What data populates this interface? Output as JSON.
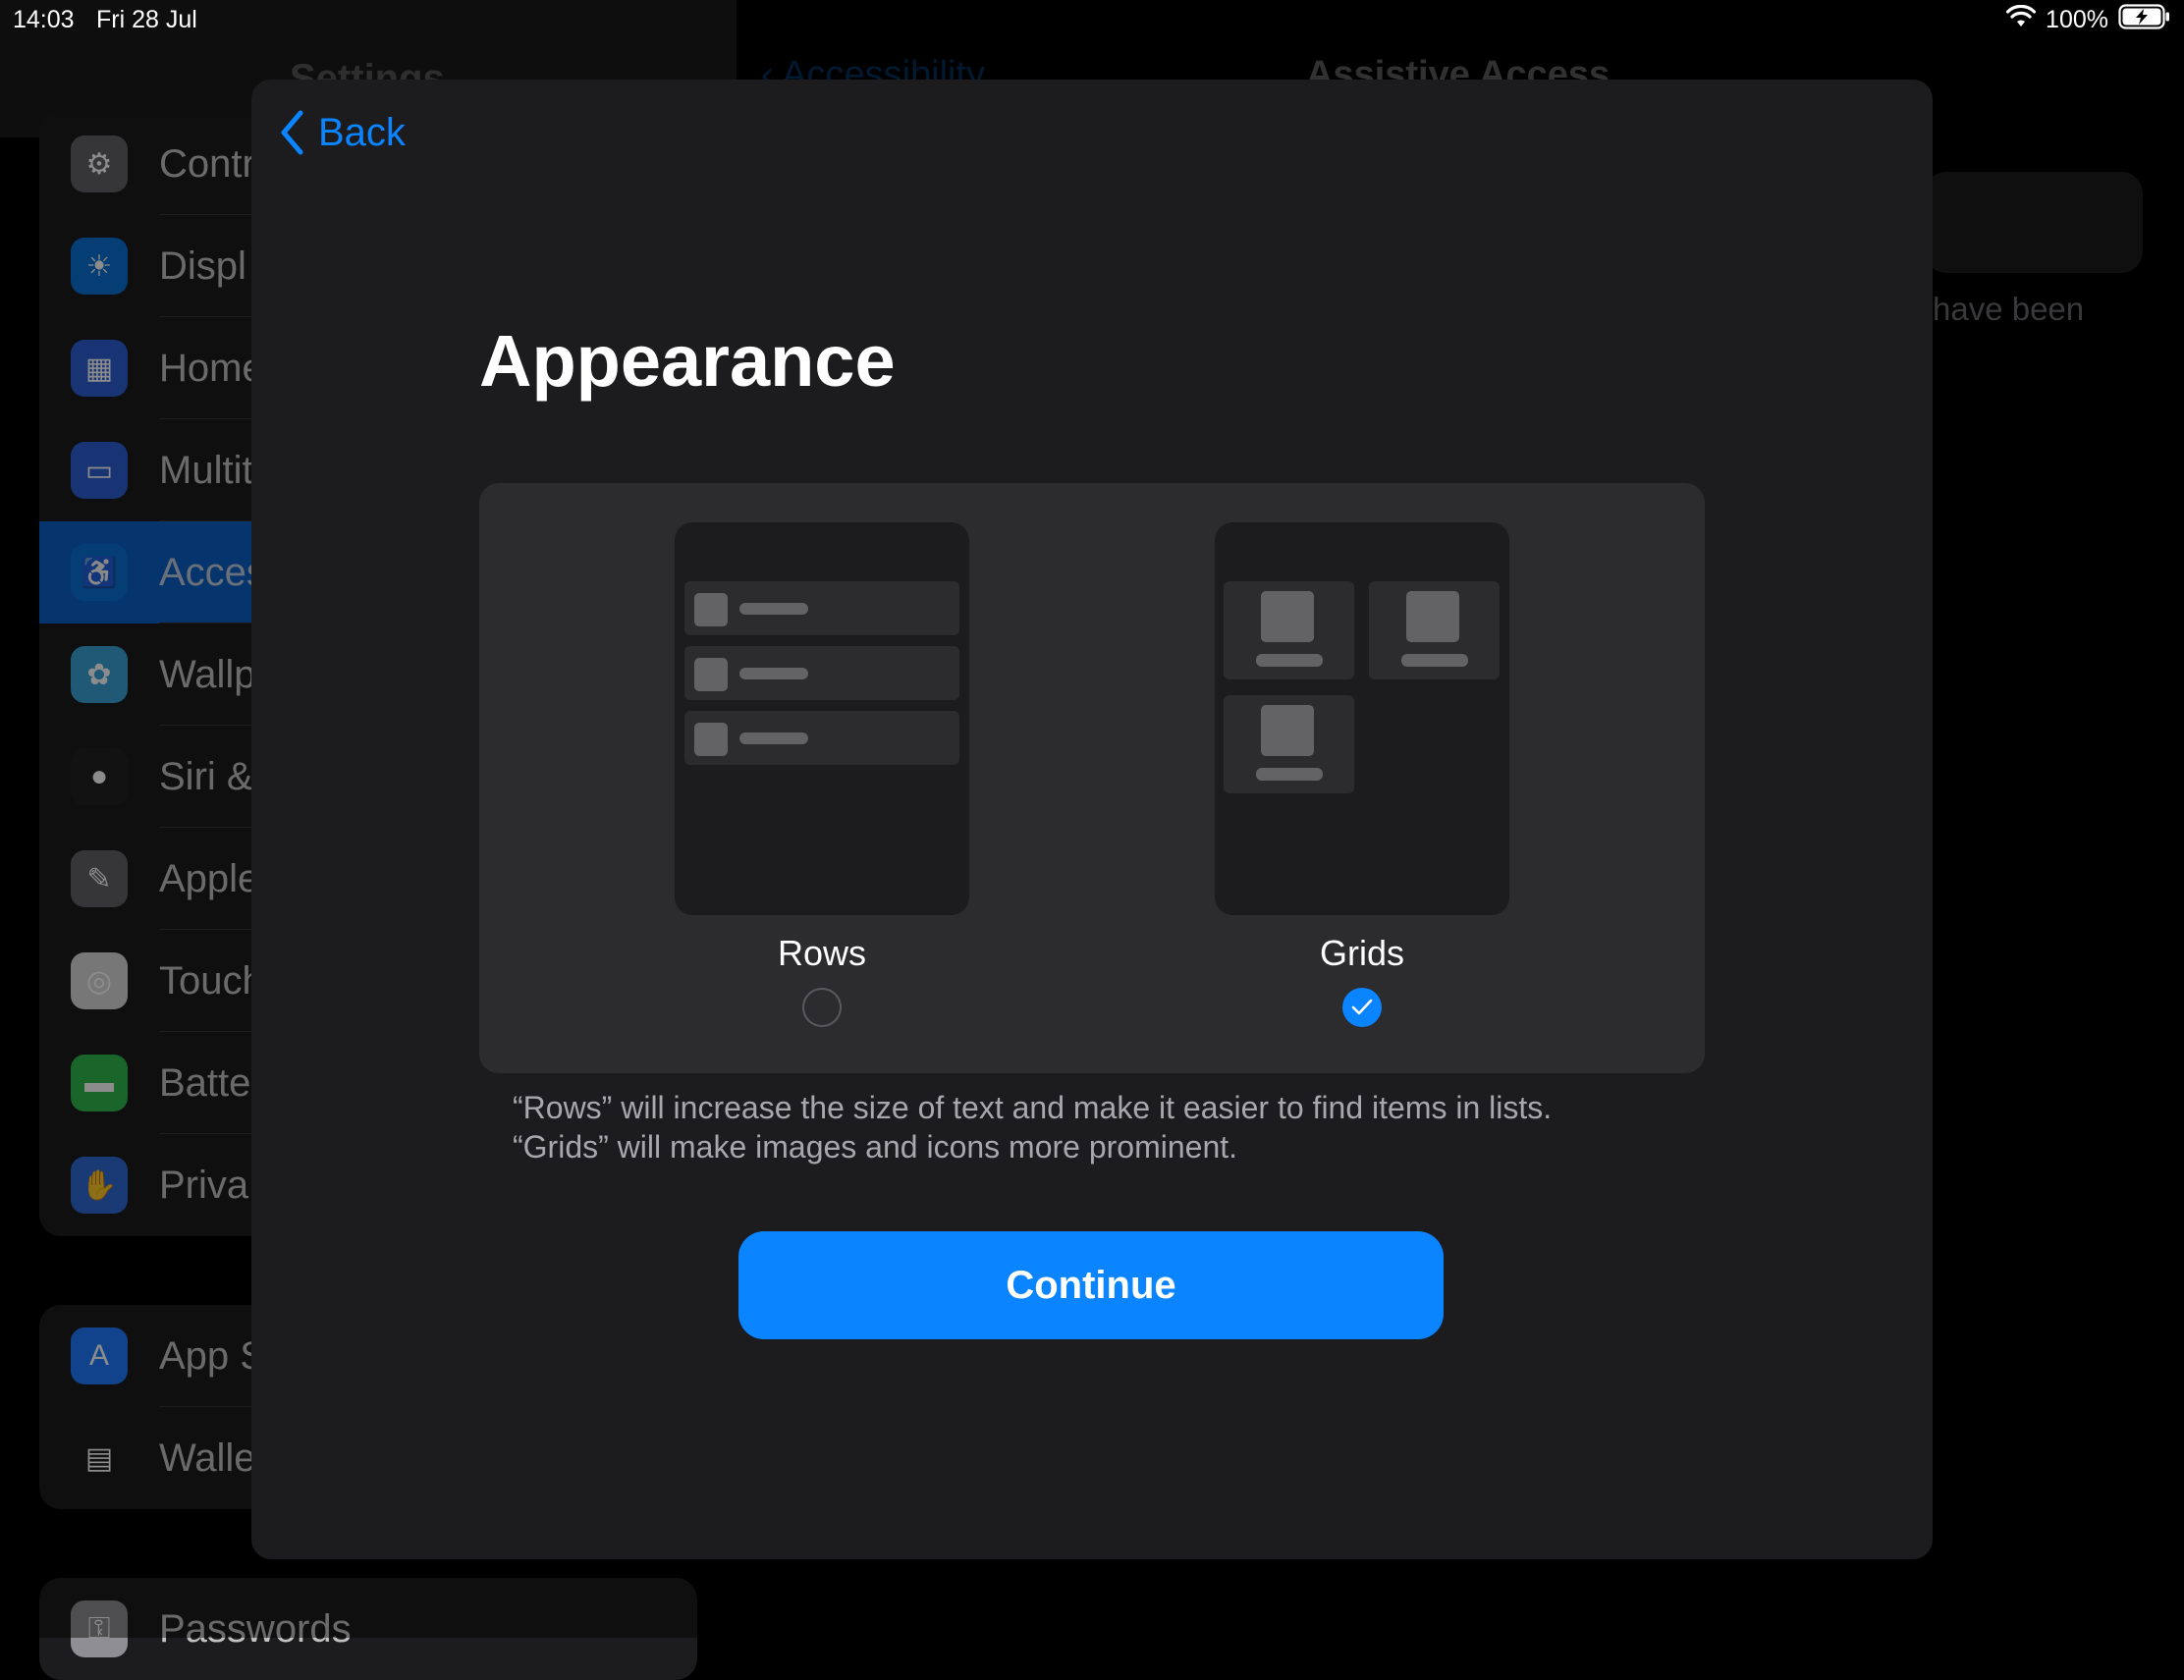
{
  "status_bar": {
    "time": "14:03",
    "date": "Fri 28 Jul",
    "battery": "100%"
  },
  "background": {
    "sidebar": {
      "groups": [
        {
          "items": [
            {
              "label": "Contr",
              "icon": "control-centre-icon",
              "color": "#636366"
            },
            {
              "label": "Displ",
              "icon": "brightness-icon",
              "color": "#0a6fd6"
            },
            {
              "label": "Home",
              "icon": "home-screen-icon",
              "color": "#2f5fd6"
            },
            {
              "label": "Multit",
              "icon": "multitasking-icon",
              "color": "#2f5fd6"
            },
            {
              "label": "Acces",
              "icon": "accessibility-icon",
              "color": "#0a6fd6",
              "selected": true
            },
            {
              "label": "Wallp",
              "icon": "wallpaper-icon",
              "color": "#3aa3d8"
            },
            {
              "label": "Siri &",
              "icon": "siri-icon",
              "color": "#222222"
            },
            {
              "label": "Apple",
              "icon": "pencil-icon",
              "color": "#636366"
            },
            {
              "label": "Touch",
              "icon": "fingerprint-icon",
              "color": "#d9d9d9"
            },
            {
              "label": "Batte",
              "icon": "battery-icon",
              "color": "#30b94d"
            },
            {
              "label": "Priva",
              "icon": "hand-icon",
              "color": "#2f6bd6"
            }
          ]
        },
        {
          "items": [
            {
              "label": "App S",
              "icon": "app-store-icon",
              "color": "#1f7bff"
            },
            {
              "label": "Walle",
              "icon": "wallet-icon",
              "color": "#1c1c1e"
            }
          ]
        },
        {
          "items": [
            {
              "label": "Passwords",
              "icon": "key-icon",
              "color": "#8e8e93"
            }
          ]
        }
      ]
    },
    "detail": {
      "note": "have been"
    }
  },
  "modal": {
    "back_label": "Back",
    "title": "Appearance",
    "options": [
      {
        "label": "Rows",
        "selected": false
      },
      {
        "label": "Grids",
        "selected": true
      }
    ],
    "footnote": [
      "“Rows” will increase the size of text and make it easier to find items in lists.",
      "“Grids” will make images and icons more prominent."
    ],
    "continue_label": "Continue"
  },
  "colors": {
    "accent": "#0a84ff",
    "modal_bg": "#1c1c1e",
    "panel_bg": "#2c2c2e"
  }
}
